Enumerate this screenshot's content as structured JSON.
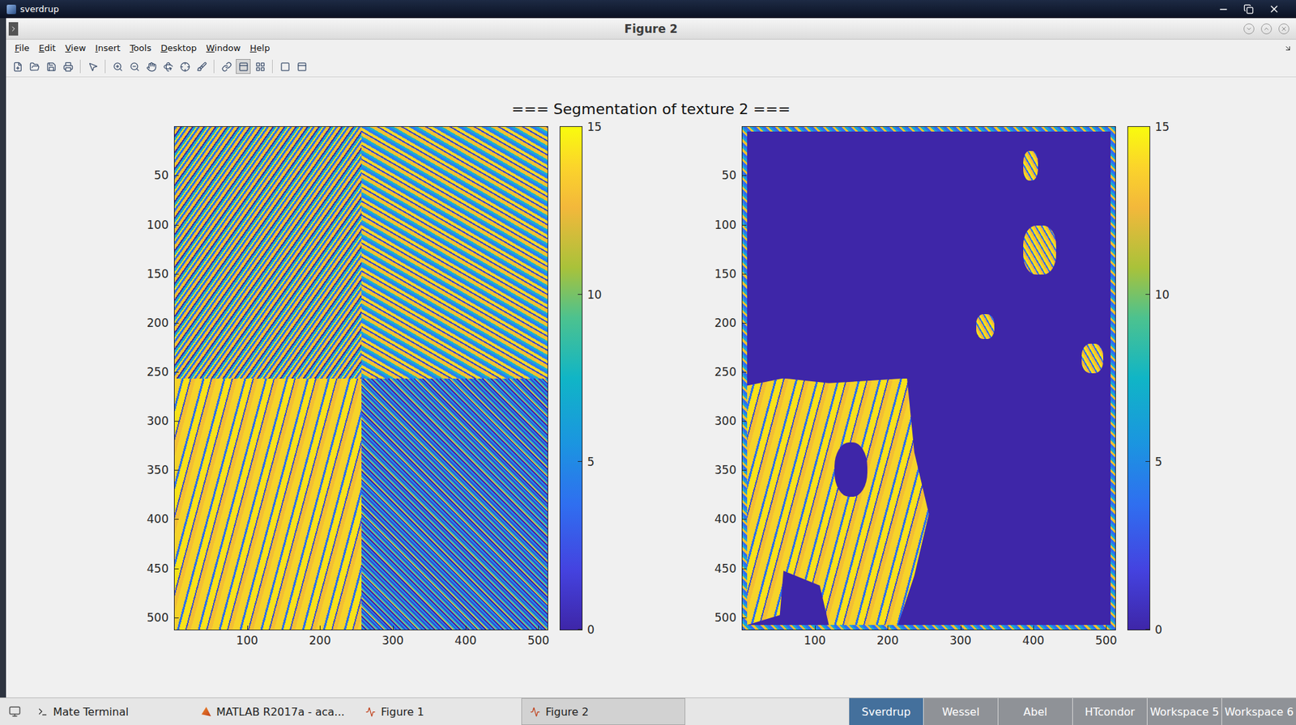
{
  "window": {
    "title": "sverdrup"
  },
  "figure": {
    "title": "Figure 2"
  },
  "menu": [
    "File",
    "Edit",
    "View",
    "Insert",
    "Tools",
    "Desktop",
    "Window",
    "Help"
  ],
  "plot": {
    "title": "=== Segmentation of texture 2 ===",
    "axes": [
      {
        "kind": "original",
        "yticks": [
          "50",
          "100",
          "150",
          "200",
          "250",
          "300",
          "350",
          "400",
          "450",
          "500"
        ],
        "xticks": [
          "100",
          "200",
          "300",
          "400",
          "500"
        ],
        "colorbar_ticks": [
          "0",
          "5",
          "10",
          "15"
        ]
      },
      {
        "kind": "segmented",
        "yticks": [
          "50",
          "100",
          "150",
          "200",
          "250",
          "300",
          "350",
          "400",
          "450",
          "500"
        ],
        "xticks": [
          "100",
          "200",
          "300",
          "400",
          "500"
        ],
        "colorbar_ticks": [
          "0",
          "5",
          "10",
          "15"
        ]
      }
    ]
  },
  "taskbar": {
    "windows": [
      {
        "label": "Mate Terminal",
        "kind": "terminal",
        "selected": false
      },
      {
        "label": "MATLAB R2017a - aca...",
        "kind": "matlab",
        "selected": false
      },
      {
        "label": "Figure 1",
        "kind": "figure",
        "selected": false
      },
      {
        "label": "Figure 2",
        "kind": "figure",
        "selected": true
      }
    ],
    "workspaces": [
      {
        "label": "Sverdrup",
        "selected": true
      },
      {
        "label": "Wessel",
        "selected": false
      },
      {
        "label": "Abel",
        "selected": false
      },
      {
        "label": "HTcondor",
        "selected": false
      },
      {
        "label": "Workspace 5",
        "selected": false
      },
      {
        "label": "Workspace 6",
        "selected": false
      }
    ]
  }
}
